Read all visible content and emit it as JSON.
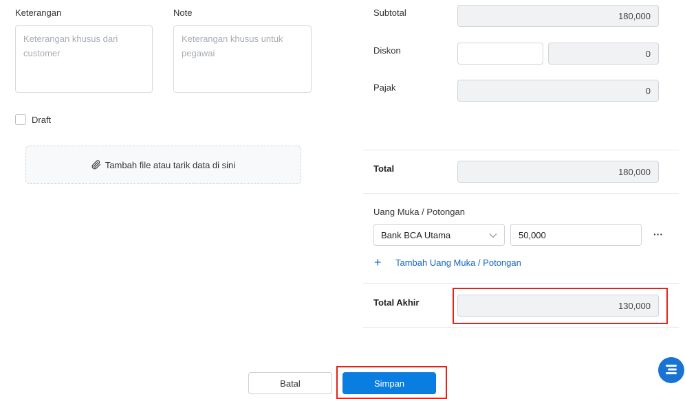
{
  "left": {
    "keterangan": {
      "label": "Keterangan",
      "placeholder": "Keterangan khusus dari customer"
    },
    "note": {
      "label": "Note",
      "placeholder": "Keterangan khusus untuk pegawai"
    },
    "draft_label": "Draft",
    "attach_label": "Tambah file atau tarik data di sini"
  },
  "summary": {
    "subtotal_label": "Subtotal",
    "subtotal_value": "180,000",
    "diskon_label": "Diskon",
    "diskon_percent": "",
    "diskon_value": "0",
    "pajak_label": "Pajak",
    "pajak_value": "0",
    "total_label": "Total",
    "total_value": "180,000",
    "uang_muka_label": "Uang Muka / Potongan",
    "uang_muka_account": "Bank BCA Utama",
    "uang_muka_amount": "50,000",
    "more_label": "···",
    "add_uang_muka_label": "Tambah Uang Muka / Potongan",
    "total_akhir_label": "Total Akhir",
    "total_akhir_value": "130,000"
  },
  "actions": {
    "cancel_label": "Batal",
    "save_label": "Simpan"
  },
  "colors": {
    "primary": "#0a7ee0",
    "highlight": "#e2231a",
    "link": "#1565c0"
  }
}
